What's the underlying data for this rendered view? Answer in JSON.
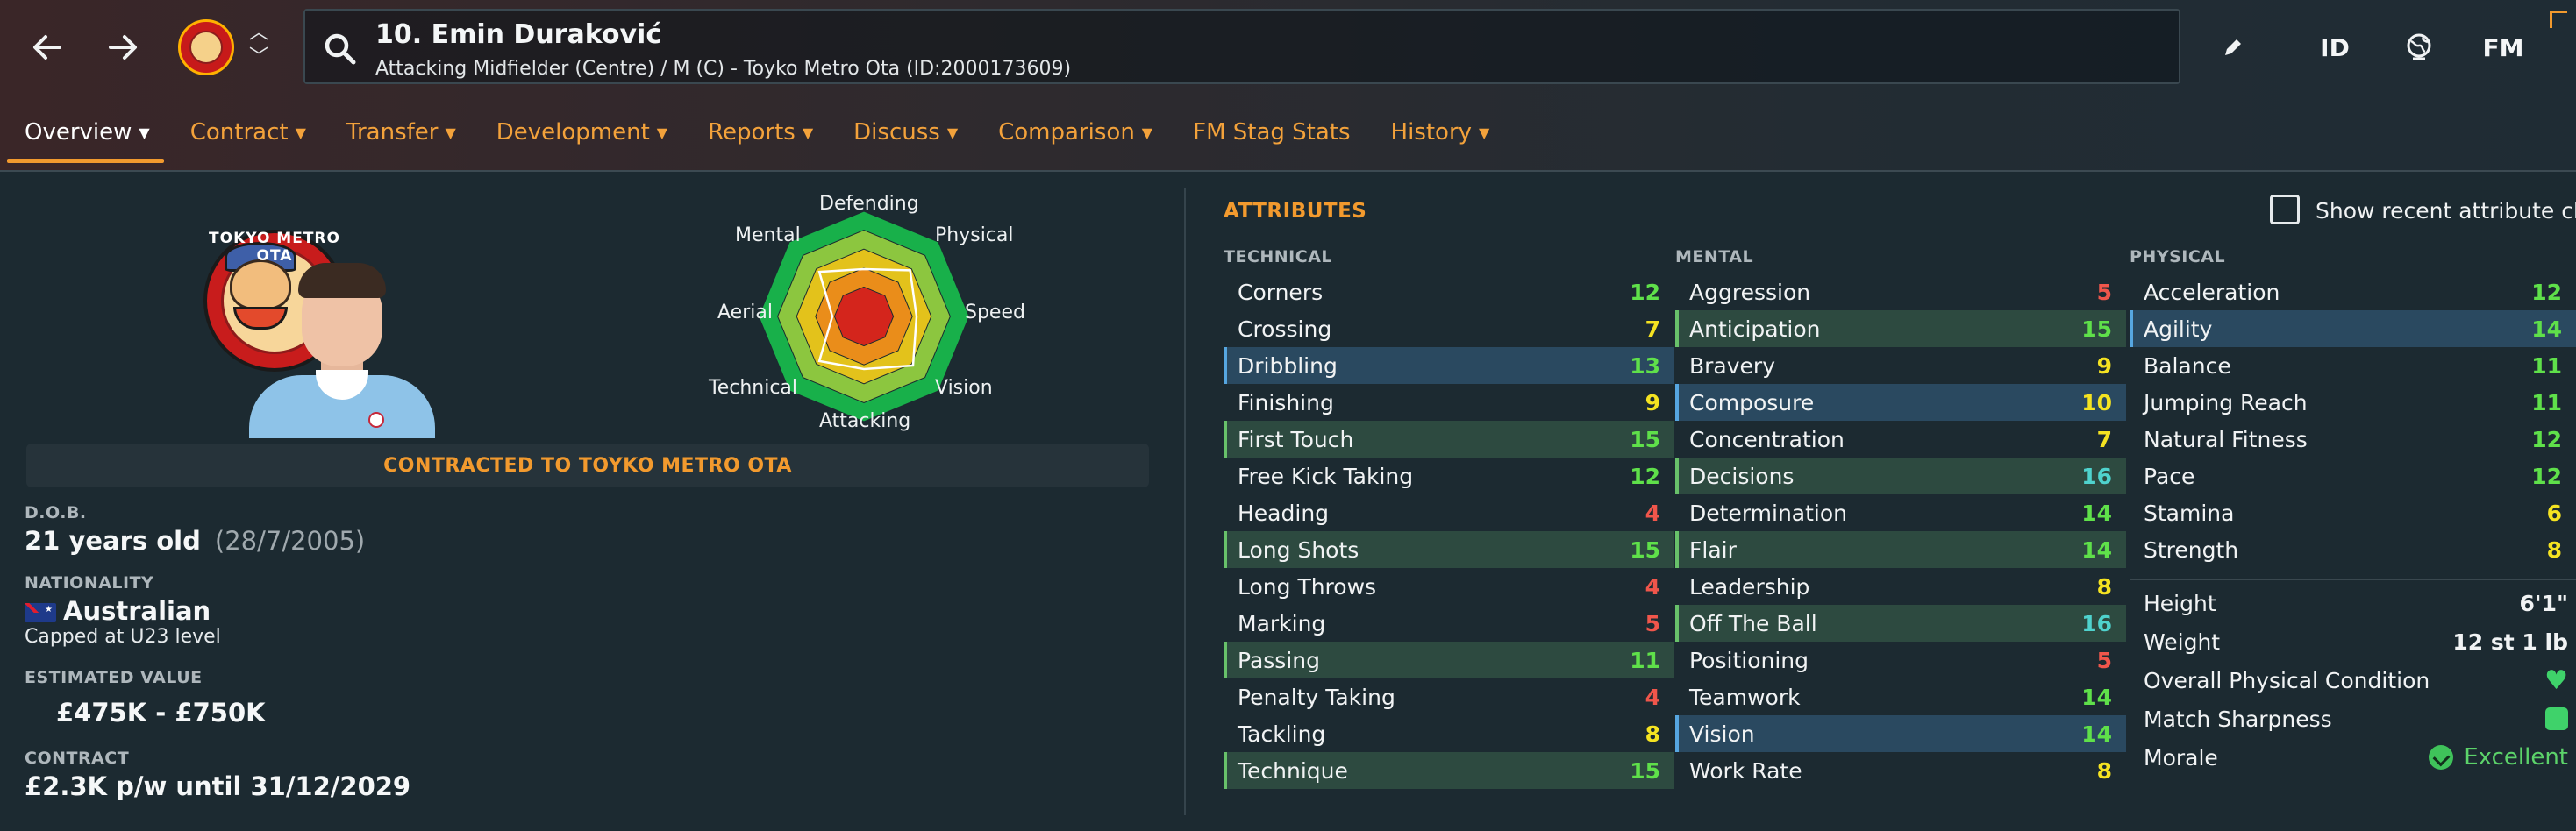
{
  "colors": {
    "accent": "#f29a2e",
    "attr_red": "#f0564b",
    "attr_yellow": "#f5e321",
    "attr_green": "#5fe04a",
    "attr_teal": "#4fd2cd"
  },
  "header": {
    "back_icon": "arrow-left-icon",
    "forward_icon": "arrow-right-icon",
    "player_title": "10. Emin Duraković",
    "player_subtitle": "Attacking Midfielder (Centre) / M (C) - Toyko Metro Ota (ID:2000173609)",
    "id_label": "ID",
    "fm_label": "FM"
  },
  "tabs": [
    {
      "label": "Overview",
      "chevron": true
    },
    {
      "label": "Contract",
      "chevron": true
    },
    {
      "label": "Transfer",
      "chevron": true
    },
    {
      "label": "Development",
      "chevron": true
    },
    {
      "label": "Reports",
      "chevron": true
    },
    {
      "label": "Discuss",
      "chevron": true
    },
    {
      "label": "Comparison",
      "chevron": true
    },
    {
      "label": "FM Stag Stats",
      "chevron": false
    },
    {
      "label": "History",
      "chevron": true
    }
  ],
  "overview": {
    "crest_text": "TOKYO METRO OTA",
    "radar_labels": {
      "defending": "Defending",
      "physical": "Physical",
      "speed": "Speed",
      "vision": "Vision",
      "attacking": "Attacking",
      "technical": "Technical",
      "aerial": "Aerial",
      "mental": "Mental"
    },
    "radar_values": {
      "defending": 0.45,
      "physical": 0.62,
      "speed": 0.5,
      "vision": 0.66,
      "attacking": 0.5,
      "technical": 0.6,
      "aerial": 0.3,
      "mental": 0.6
    },
    "contract_banner": "CONTRACTED TO TOYKO METRO OTA",
    "dob_label": "D.O.B.",
    "age": "21 years old",
    "dob": "(28/7/2005)",
    "nationality_label": "NATIONALITY",
    "nationality": "Australian",
    "capped": "Capped at U23 level",
    "value_label": "ESTIMATED VALUE",
    "value": "£475K - £750K",
    "contract_label": "CONTRACT",
    "contract": "£2.3K p/w until 31/12/2029"
  },
  "attributes": {
    "title": "ATTRIBUTES",
    "show_recent_label": "Show recent attribute changes",
    "technical_label": "TECHNICAL",
    "mental_label": "MENTAL",
    "physical_label": "PHYSICAL",
    "technical": [
      {
        "name": "Corners",
        "value": 12,
        "hl": ""
      },
      {
        "name": "Crossing",
        "value": 7,
        "hl": ""
      },
      {
        "name": "Dribbling",
        "value": 13,
        "hl": "blue"
      },
      {
        "name": "Finishing",
        "value": 9,
        "hl": ""
      },
      {
        "name": "First Touch",
        "value": 15,
        "hl": "green"
      },
      {
        "name": "Free Kick Taking",
        "value": 12,
        "hl": ""
      },
      {
        "name": "Heading",
        "value": 4,
        "hl": ""
      },
      {
        "name": "Long Shots",
        "value": 15,
        "hl": "green"
      },
      {
        "name": "Long Throws",
        "value": 4,
        "hl": ""
      },
      {
        "name": "Marking",
        "value": 5,
        "hl": ""
      },
      {
        "name": "Passing",
        "value": 11,
        "hl": "green"
      },
      {
        "name": "Penalty Taking",
        "value": 4,
        "hl": ""
      },
      {
        "name": "Tackling",
        "value": 8,
        "hl": ""
      },
      {
        "name": "Technique",
        "value": 15,
        "hl": "green"
      }
    ],
    "mental": [
      {
        "name": "Aggression",
        "value": 5,
        "hl": ""
      },
      {
        "name": "Anticipation",
        "value": 15,
        "hl": "green"
      },
      {
        "name": "Bravery",
        "value": 9,
        "hl": ""
      },
      {
        "name": "Composure",
        "value": 10,
        "hl": "blue"
      },
      {
        "name": "Concentration",
        "value": 7,
        "hl": ""
      },
      {
        "name": "Decisions",
        "value": 16,
        "hl": "green"
      },
      {
        "name": "Determination",
        "value": 14,
        "hl": ""
      },
      {
        "name": "Flair",
        "value": 14,
        "hl": "green"
      },
      {
        "name": "Leadership",
        "value": 8,
        "hl": ""
      },
      {
        "name": "Off The Ball",
        "value": 16,
        "hl": "green"
      },
      {
        "name": "Positioning",
        "value": 5,
        "hl": ""
      },
      {
        "name": "Teamwork",
        "value": 14,
        "hl": ""
      },
      {
        "name": "Vision",
        "value": 14,
        "hl": "blue"
      },
      {
        "name": "Work Rate",
        "value": 8,
        "hl": ""
      }
    ],
    "physical": [
      {
        "name": "Acceleration",
        "value": 12,
        "hl": ""
      },
      {
        "name": "Agility",
        "value": 14,
        "hl": "blue"
      },
      {
        "name": "Balance",
        "value": 11,
        "hl": ""
      },
      {
        "name": "Jumping Reach",
        "value": 11,
        "hl": ""
      },
      {
        "name": "Natural Fitness",
        "value": 12,
        "hl": ""
      },
      {
        "name": "Pace",
        "value": 12,
        "hl": ""
      },
      {
        "name": "Stamina",
        "value": 6,
        "hl": ""
      },
      {
        "name": "Strength",
        "value": 8,
        "hl": ""
      }
    ],
    "physical_extra": {
      "height_label": "Height",
      "height": "6'1\"",
      "weight_label": "Weight",
      "weight": "12 st 1 lb",
      "condition_label": "Overall Physical Condition",
      "sharpness_label": "Match Sharpness",
      "morale_label": "Morale",
      "morale": "Excellent"
    }
  }
}
